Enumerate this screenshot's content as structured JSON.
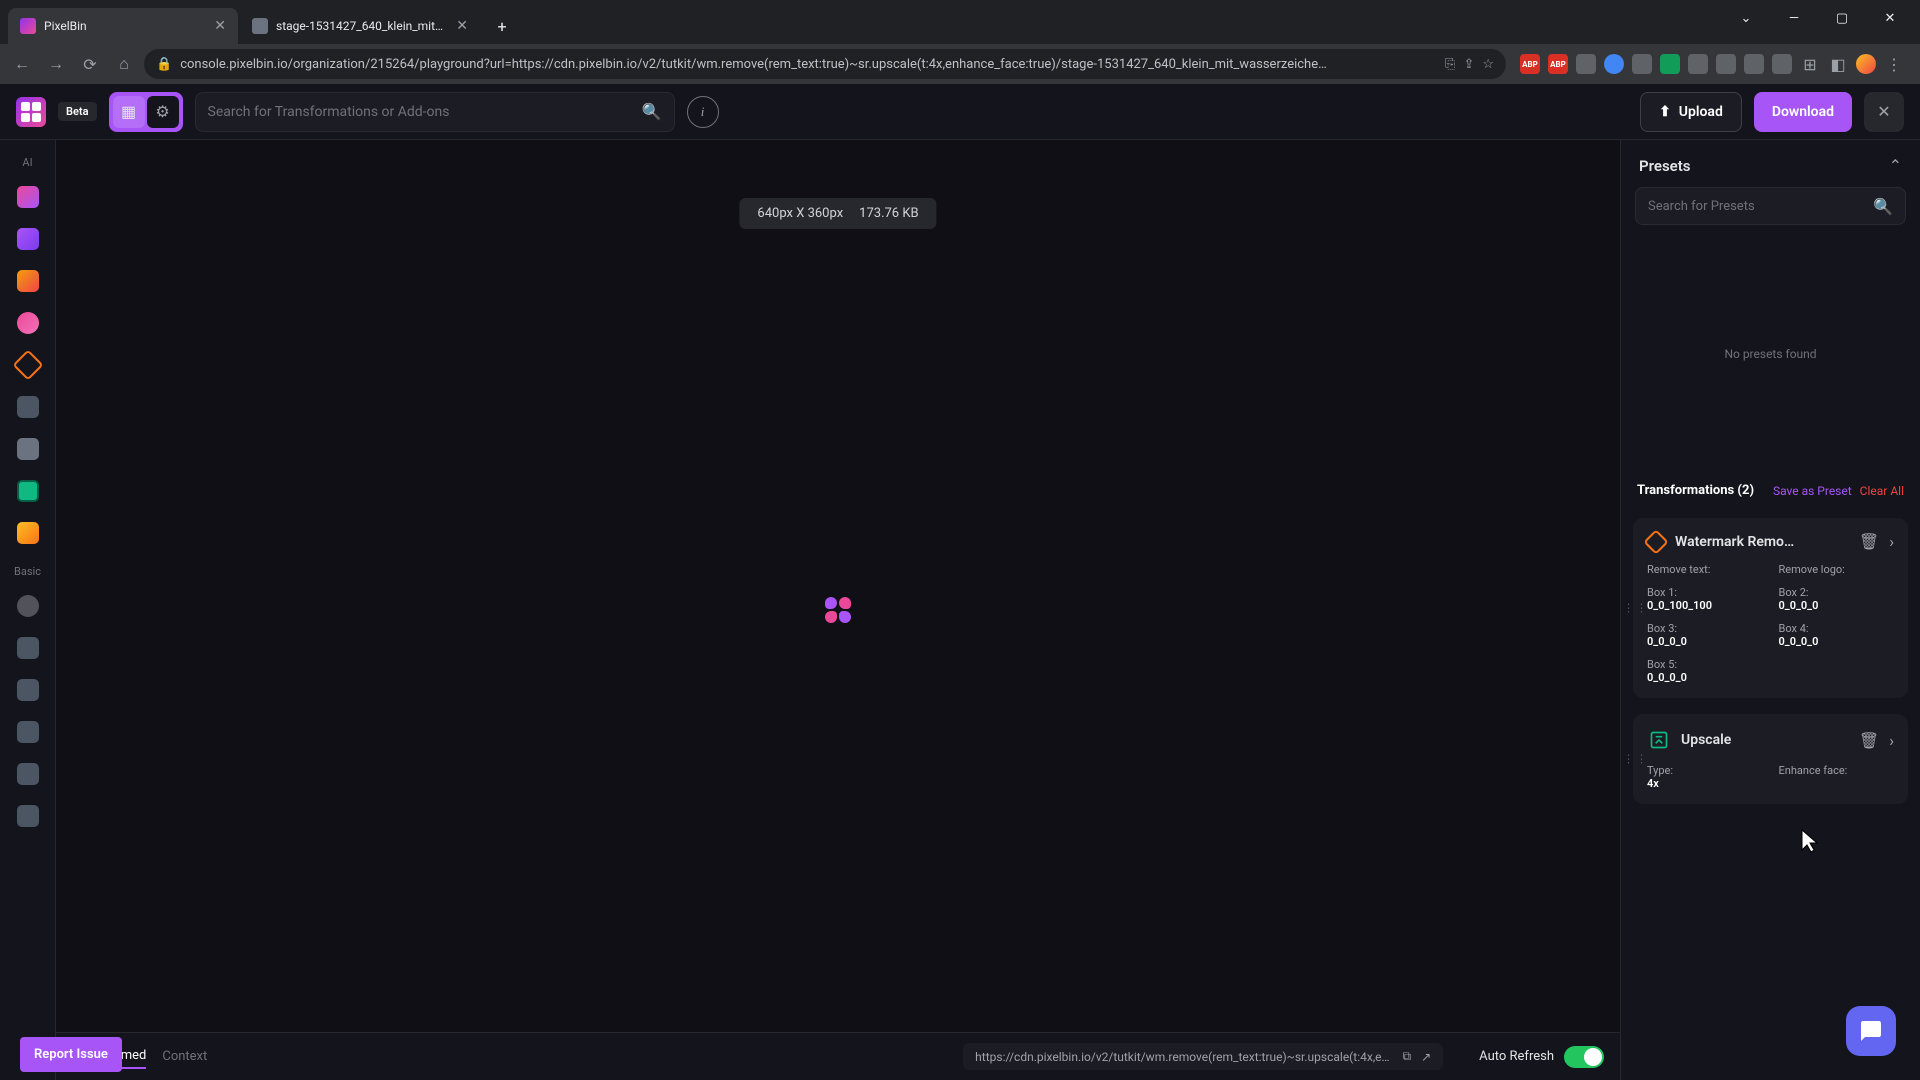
{
  "browser": {
    "tabs": [
      {
        "title": "PixelBin",
        "active": true
      },
      {
        "title": "stage-1531427_640_klein_mit_w…",
        "active": false
      }
    ],
    "url": "console.pixelbin.io/organization/215264/playground?url=https://cdn.pixelbin.io/v2/tutkit/wm.remove(rem_text:true)~sr.upscale(t:4x,enhance_face:true)/stage-1531427_640_klein_mit_wasserzeiche…",
    "ext_badges": [
      "ABP",
      "ABP"
    ]
  },
  "topbar": {
    "beta": "Beta",
    "search_placeholder": "Search for Transformations or Add-ons",
    "upload": "Upload",
    "download": "Download"
  },
  "sidebar": {
    "section_ai": "AI",
    "section_basic": "Basic"
  },
  "canvas": {
    "dimensions": "640px X 360px",
    "filesize": "173.76 KB"
  },
  "presets": {
    "title": "Presets",
    "search_placeholder": "Search for Presets",
    "empty": "No presets found"
  },
  "transformations": {
    "title": "Transformations (2)",
    "save_as_preset": "Save as Preset",
    "clear_all": "Clear All",
    "items": [
      {
        "name": "Watermark Remo…",
        "params": [
          {
            "label": "Remove text:",
            "value": ""
          },
          {
            "label": "Remove logo:",
            "value": ""
          },
          {
            "label": "Box 1:",
            "value": "0_0_100_100"
          },
          {
            "label": "Box 2:",
            "value": "0_0_0_0"
          },
          {
            "label": "Box 3:",
            "value": "0_0_0_0"
          },
          {
            "label": "Box 4:",
            "value": "0_0_0_0"
          },
          {
            "label": "Box 5:",
            "value": "0_0_0_0"
          }
        ]
      },
      {
        "name": "Upscale",
        "params": [
          {
            "label": "Type:",
            "value": "4x"
          },
          {
            "label": "Enhance face:",
            "value": ""
          }
        ]
      }
    ]
  },
  "bottom": {
    "tabs": {
      "transformed": "Transformed",
      "context": "Context"
    },
    "url_display": "https://cdn.pixelbin.io/v2/tutkit/wm.remove(rem_text:true)~sr.upscale(t:4x,enhance…",
    "auto_refresh": "Auto Refresh"
  },
  "report_issue": "Report Issue"
}
